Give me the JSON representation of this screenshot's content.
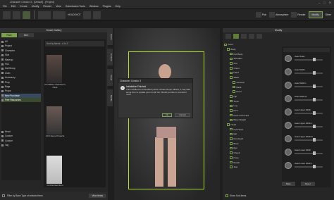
{
  "window": {
    "title": "Character Creator 3 - [Default] - [Project]"
  },
  "menu": [
    "File",
    "Edit",
    "Create",
    "Modify",
    "Render",
    "View",
    "Submission Tools",
    "Window",
    "Plugins",
    "Help"
  ],
  "toolbar": {
    "labels": [
      "Pick",
      "Atmosphere",
      "Render",
      "HEADSHOT"
    ],
    "right": {
      "modify": "Modify",
      "other": "Other"
    }
  },
  "content": {
    "header": "Smart Gallery",
    "tabs": [
      "Pack",
      "Item"
    ],
    "search_placeholder": "Sort by Name - A to Z",
    "tree": [
      "All",
      "Project",
      "Character",
      "Skin",
      "Makeup",
      "FAC",
      "HairGroup",
      "Cloth",
      "Accessory",
      "Prop",
      "Bags",
      "Props",
      "New Purchase",
      "Free Resources"
    ],
    "tree2": [
      "Head",
      "Custom",
      "Custom",
      "Tag"
    ],
    "thumbs": [
      "CC3 Base Character's Pack",
      "CC3 Demo Projects",
      "CC3 Embed Item"
    ],
    "footer": {
      "filter_label": "Filter by Base Type of selected Item",
      "view_btn": "View Items"
    }
  },
  "side_tabs": [
    "Scene",
    "Content",
    "Visual",
    "Modify"
  ],
  "dialog": {
    "title": "Character Creator 3",
    "heading": "Installation Finished",
    "body": "This installed an embedded packs include Morph Sliders, it may take some time to update your morph list. Would you like to process it now?",
    "ok": "Ok",
    "cancel": "Cancel"
  },
  "modify": {
    "header": "Modify",
    "tree": [
      "Actor",
      "Body",
      "Full Body",
      "Shoulder",
      "Arm",
      "Chest",
      "Hand",
      "Waist",
      "General",
      "Back",
      "Front",
      "Hip",
      "Torso",
      "Leg",
      "Foot",
      "Pose Corrected",
      "Base Weight",
      "Head",
      "Full Head",
      "Ear",
      "Forehead",
      "Brow",
      "Eye",
      "Cheek",
      "Nose",
      "Mouth",
      "Jaw"
    ],
    "sliders": [
      "Head Scale",
      "Head Width",
      "Head Width L",
      "Head Width R",
      "Head Upper Width",
      "Head Upper Width L",
      "Head Upper Width R",
      "Head Lower Width",
      "Head Lower Width L"
    ],
    "buttons": [
      "Bake",
      "Reset"
    ],
    "footer": "Show Sub-Items"
  }
}
